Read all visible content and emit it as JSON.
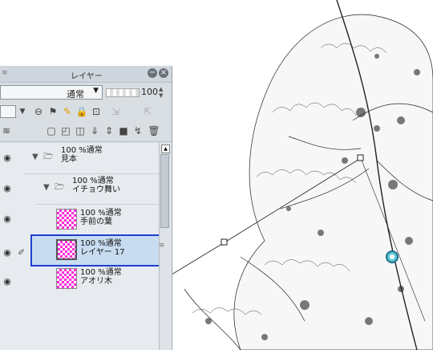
{
  "panel": {
    "title": "レイヤー",
    "blend_mode": "通常",
    "opacity": "100",
    "layers": [
      {
        "name": "見本",
        "mode": "100 %通常",
        "type": "folder"
      },
      {
        "name": "イチョウ舞い",
        "mode": "100 %通常",
        "type": "folder"
      },
      {
        "name": "手前の葉",
        "mode": "100 %通常",
        "type": "raster"
      },
      {
        "name": "レイヤー 17",
        "mode": "100 %通常",
        "type": "raster",
        "selected": true
      },
      {
        "name": "アオリ木",
        "mode": "100 %通常",
        "type": "raster"
      }
    ]
  },
  "colors": {
    "selection_border": "#1f3ecf",
    "thumbnail_magenta": "#ff2bd6",
    "panel_bg": "#d9dee3"
  }
}
